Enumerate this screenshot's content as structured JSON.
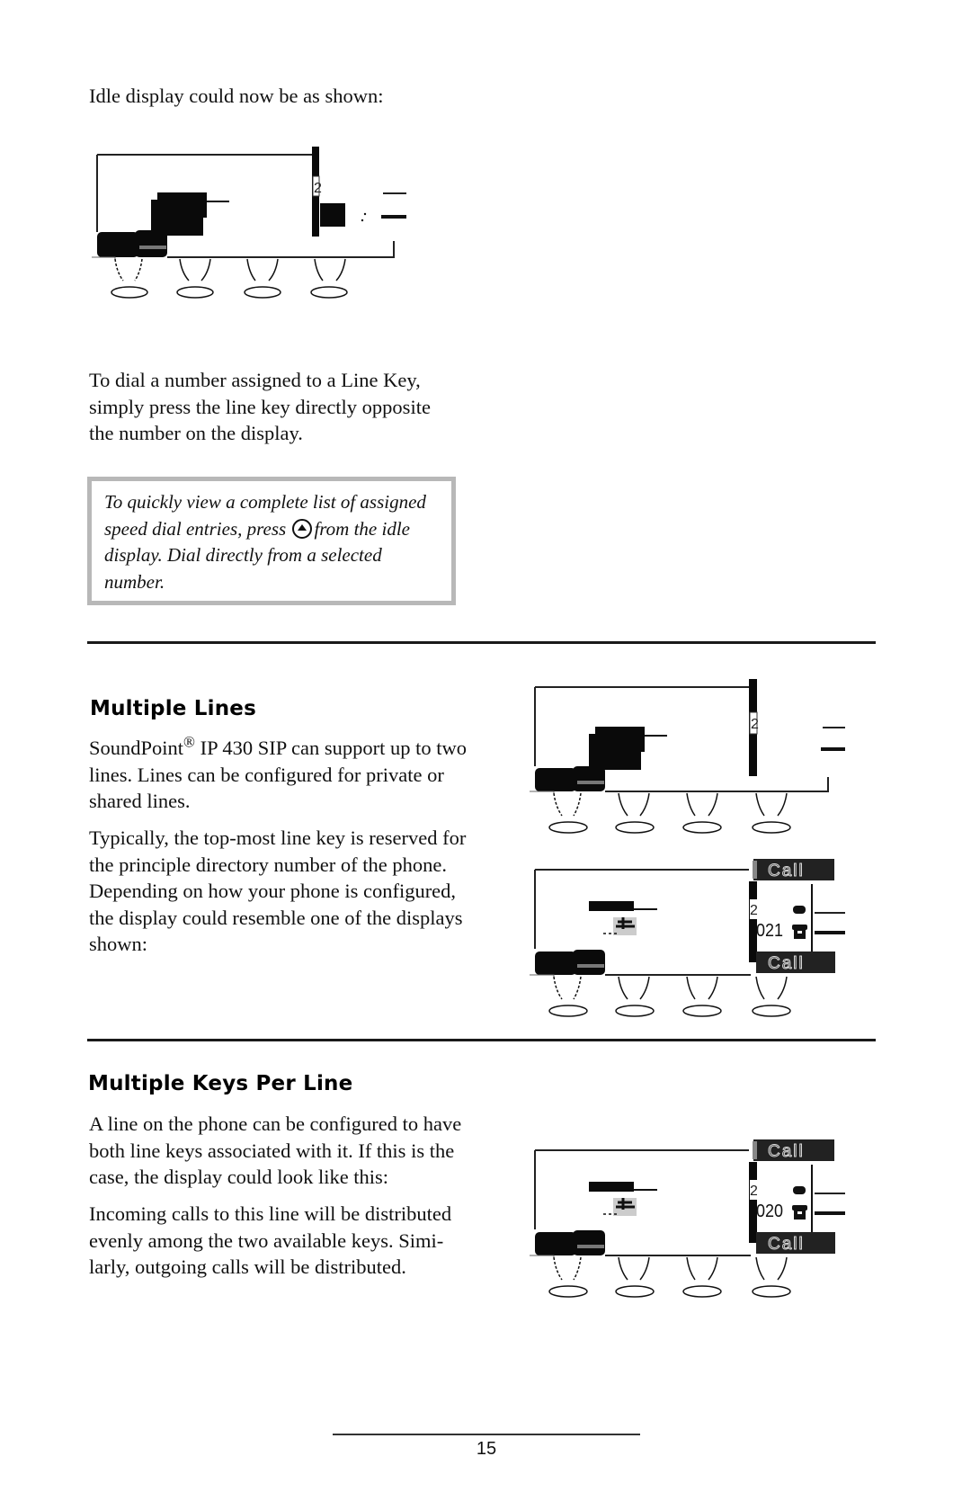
{
  "intro": {
    "idle_caption": "Idle display could now be as shown:",
    "dial_paragraph": [
      "To dial a number assigned to a Line Key,",
      "simply press the line key directly opposite",
      "the number on the display."
    ],
    "tip": {
      "line1": "To quickly view a complete list of assigned",
      "line2_before": "speed dial entries, press",
      "line2_icon": "up-arrow-button-icon",
      "line2_after": "from the idle",
      "line3": "display.  Dial directly from a selected",
      "line4": "number."
    }
  },
  "multiple_lines": {
    "heading": "Multiple Lines",
    "para1": {
      "brand": "SoundPoint",
      "reg_mark": "®",
      "rest_line1": " IP 430 SIP can support up to two",
      "line2": "lines.  Lines can be configured for private or",
      "line3": "shared lines."
    },
    "para2": [
      "Typically, the top-most line key is reserved for",
      "the principle directory number of the phone.",
      "Depending on how your phone is configured,",
      "the display could resemble one of the displays",
      "shown:"
    ],
    "display2": {
      "softkey_top": "Call",
      "softkey_bottom": "Call",
      "line_number": "021",
      "line_label_fragment": "2"
    }
  },
  "multiple_keys": {
    "heading": "Multiple Keys Per Line",
    "para1": [
      "A line on the phone can be configured to have",
      "both line keys associated with it.  If this is the",
      "case, the display could look like this:"
    ],
    "para2": [
      "Incoming calls to this line will be distributed",
      "evenly among the two available keys.  Simi-",
      "larly, outgoing calls will be distributed."
    ],
    "display": {
      "softkey_top": "Call",
      "softkey_bottom": "Call",
      "line_number": "020",
      "line_label_fragment": "2"
    }
  },
  "idle_display": {
    "line_label_fragment": "2"
  },
  "footer": {
    "page_number": "15"
  }
}
